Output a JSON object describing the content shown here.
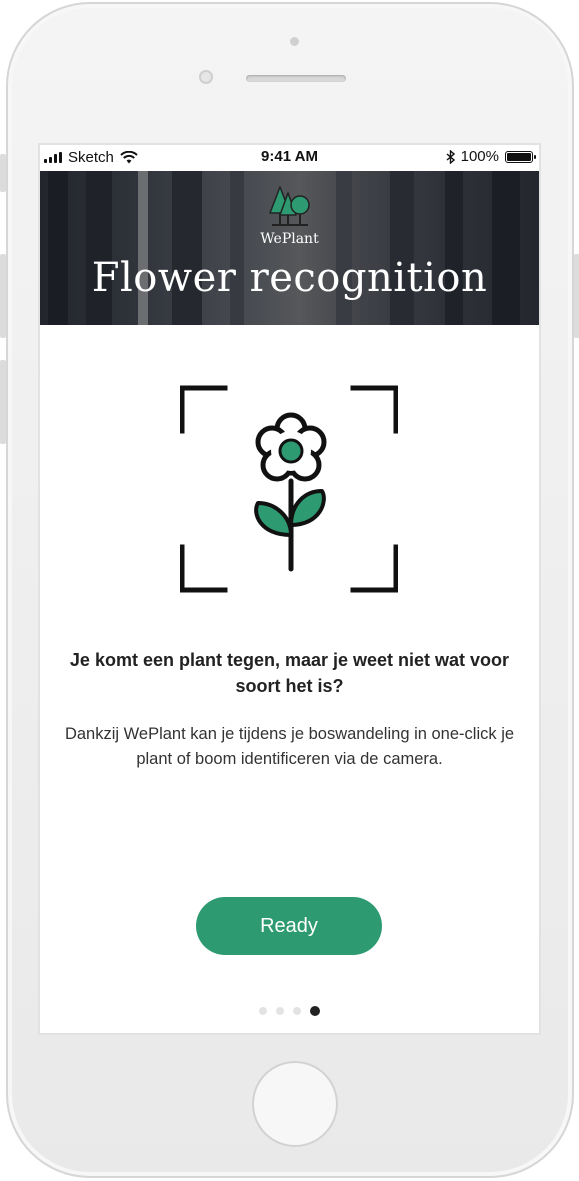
{
  "status_bar": {
    "carrier": "Sketch",
    "time": "9:41 AM",
    "battery_percent": "100%",
    "battery_level": 1.0
  },
  "header": {
    "brand": "WePlant",
    "title": "Flower recognition"
  },
  "onboarding": {
    "headline": "Je komt een plant tegen, maar je weet niet wat voor soort het is?",
    "description": "Dankzij WePlant kan je tijdens je boswandeling in one-click je plant of boom identificeren via de camera.",
    "ready_label": "Ready",
    "pages_total": 4,
    "current_page": 4
  },
  "icons": [
    "signal-icon",
    "wifi-icon",
    "bluetooth-icon",
    "battery-icon",
    "weplant-logo-icon",
    "flower-scan-icon"
  ],
  "colors": {
    "accent": "#2e9a72",
    "text_dark": "#222222"
  }
}
